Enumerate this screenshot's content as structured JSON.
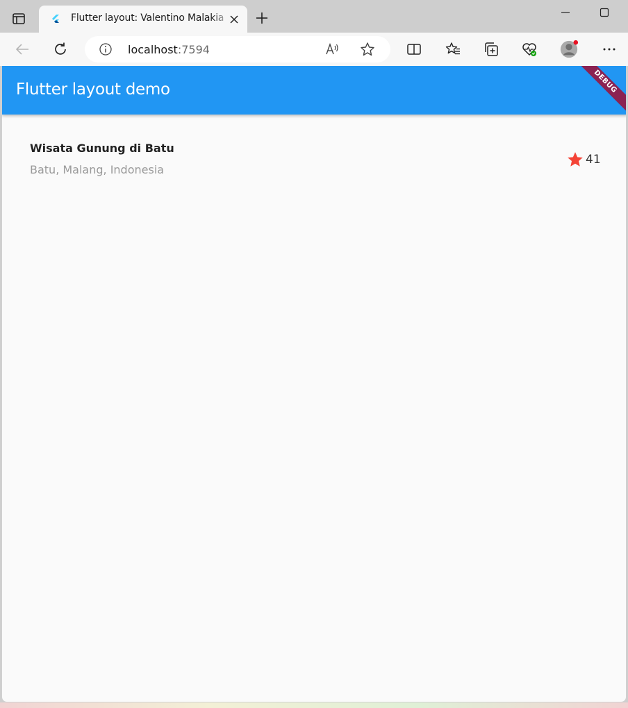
{
  "browser": {
    "tab": {
      "title": "Flutter layout: Valentino Malakian"
    },
    "address": {
      "host": "localhost",
      "port": ":7594"
    }
  },
  "app": {
    "appbar_title": "Flutter layout demo",
    "debug_banner": "DEBUG",
    "accent_color": "#2196f3",
    "place": {
      "title": "Wisata Gunung di Batu",
      "subtitle": "Batu, Malang, Indonesia"
    },
    "rating": {
      "icon": "star-icon",
      "color": "#f44336",
      "count": "41"
    }
  }
}
